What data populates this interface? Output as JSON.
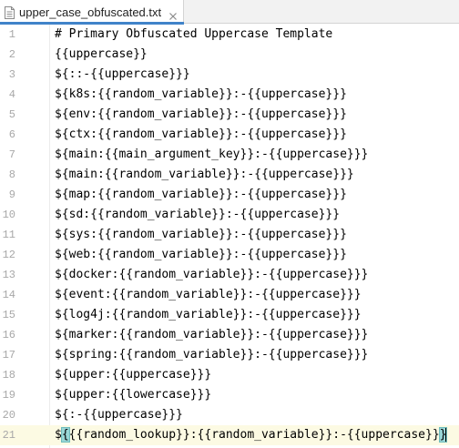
{
  "tab": {
    "filename": "upper_case_obfuscated.txt",
    "file_icon": "text-file-icon",
    "close_icon": "close-icon"
  },
  "editor": {
    "lines": [
      {
        "number": "1",
        "text": "# Primary Obfuscated Uppercase Template"
      },
      {
        "number": "2",
        "text": "{{uppercase}}"
      },
      {
        "number": "3",
        "text": "${::-{{uppercase}}}"
      },
      {
        "number": "4",
        "text": "${k8s:{{random_variable}}:-{{uppercase}}}"
      },
      {
        "number": "5",
        "text": "${env:{{random_variable}}:-{{uppercase}}}"
      },
      {
        "number": "6",
        "text": "${ctx:{{random_variable}}:-{{uppercase}}}"
      },
      {
        "number": "7",
        "text": "${main:{{main_argument_key}}:-{{uppercase}}}"
      },
      {
        "number": "8",
        "text": "${main:{{random_variable}}:-{{uppercase}}}"
      },
      {
        "number": "9",
        "text": "${map:{{random_variable}}:-{{uppercase}}}"
      },
      {
        "number": "10",
        "text": "${sd:{{random_variable}}:-{{uppercase}}}"
      },
      {
        "number": "11",
        "text": "${sys:{{random_variable}}:-{{uppercase}}}"
      },
      {
        "number": "12",
        "text": "${web:{{random_variable}}:-{{uppercase}}}"
      },
      {
        "number": "13",
        "text": "${docker:{{random_variable}}:-{{uppercase}}}"
      },
      {
        "number": "14",
        "text": "${event:{{random_variable}}:-{{uppercase}}}"
      },
      {
        "number": "15",
        "text": "${log4j:{{random_variable}}:-{{uppercase}}}"
      },
      {
        "number": "16",
        "text": "${marker:{{random_variable}}:-{{uppercase}}}"
      },
      {
        "number": "17",
        "text": "${spring:{{random_variable}}:-{{uppercase}}}"
      },
      {
        "number": "18",
        "text": "${upper:{{uppercase}}}"
      },
      {
        "number": "19",
        "text": "${upper:{{lowercase}}}"
      },
      {
        "number": "20",
        "text": "${:-{{uppercase}}}"
      },
      {
        "number": "21",
        "text_pre": "$",
        "brace_open": "{",
        "text_mid": "{{random_lookup}}:{{random_variable}}:-{{uppercase}}",
        "brace_close": "}",
        "current": true
      }
    ]
  },
  "colors": {
    "tab_accent": "#4083c9",
    "current_line_bg": "#fcfae3",
    "brace_match_bg": "#99d6d6",
    "line_number": "#a8a8a8",
    "text": "#000000"
  }
}
